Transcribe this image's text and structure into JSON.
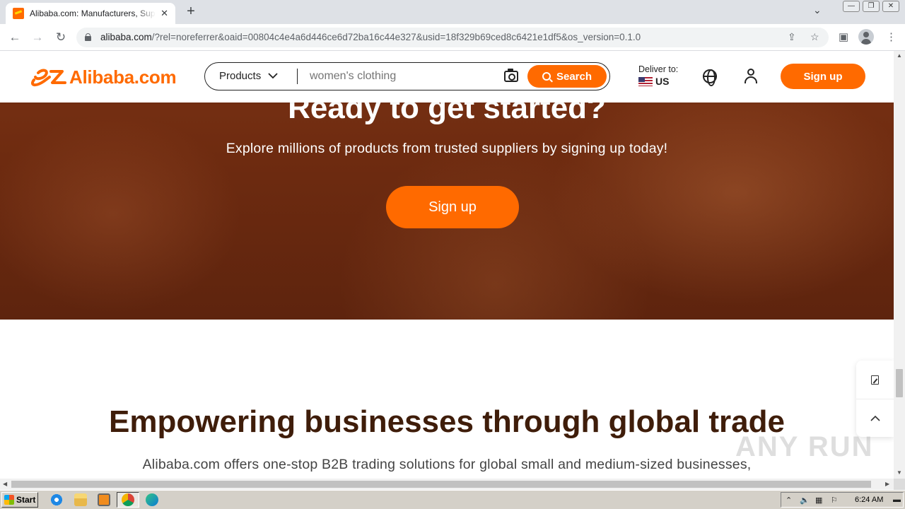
{
  "browser": {
    "tab_title": "Alibaba.com: Manufacturers, Suppliers, Exporters & Importers from the world's largest online B2B marketplace",
    "url_host": "alibaba.com",
    "url_path": "/?rel=noreferrer&oaid=00804c4e4a6d446ce6d72ba16c44e327&usid=18f329b69ced8c6421e1df5&os_version=0.1.0"
  },
  "header": {
    "logo_text": "Alibaba.com",
    "search_category": "Products",
    "search_placeholder": "women's clothing",
    "search_button": "Search",
    "deliver_label": "Deliver to:",
    "deliver_country": "US",
    "signup_button": "Sign up"
  },
  "hero": {
    "title": "Ready to get started?",
    "subtitle": "Explore millions of products from trusted suppliers by signing up today!",
    "signup_button": "Sign up"
  },
  "section": {
    "title": "Empowering businesses through global trade",
    "subtitle": "Alibaba.com offers one-stop B2B trading solutions for global small and medium-sized businesses,"
  },
  "watermark": "ANY RUN",
  "taskbar": {
    "start_label": "Start",
    "clock": "6:24 AM"
  },
  "colors": {
    "brand": "#ff6a00",
    "hero_bg": "#6e2b10",
    "heading": "#3f1d0a"
  }
}
